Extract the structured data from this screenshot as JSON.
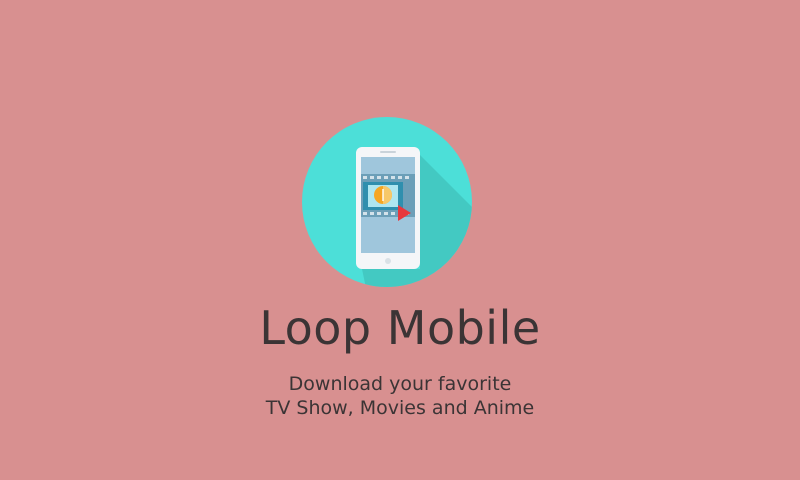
{
  "colors": {
    "background": "#d89090",
    "circle": "#4cdfd8",
    "circle_shadow": "#43c9c2",
    "phone_body": "#f4f6f8",
    "phone_screen": "#9fc6dc",
    "film_strip": "#6c9fb8",
    "film_holes": "#d3e2ea",
    "film_frame": "#2f8fae",
    "film_center": "#f5a623",
    "play_button": "#e8383d",
    "text": "#3b3435"
  },
  "icons": {
    "logo": "phone-film-play-icon"
  },
  "splash": {
    "title": "Loop Mobile",
    "tagline_line1": "Download your favorite",
    "tagline_line2": "TV Show, Movies and Anime"
  }
}
